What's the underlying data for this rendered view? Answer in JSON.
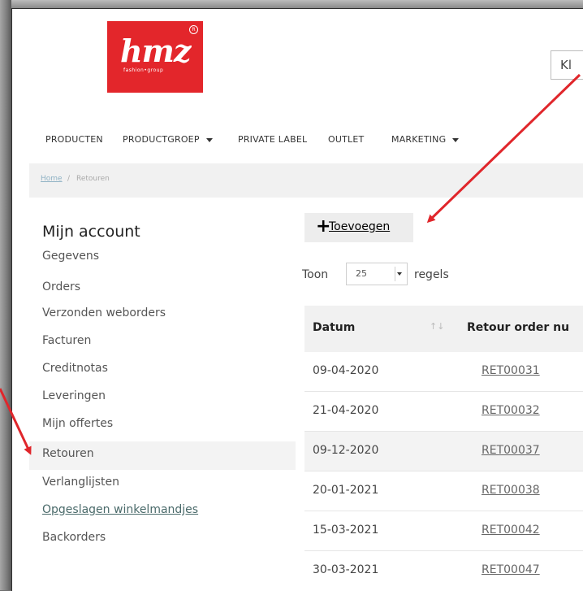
{
  "logo": {
    "text": "hmz",
    "subtext": "fashion•group",
    "reg_mark": "R"
  },
  "search": {
    "partial_text": "Kl"
  },
  "nav": {
    "items": [
      {
        "label": "PRODUCTEN",
        "dropdown": false
      },
      {
        "label": "PRODUCTGROEP",
        "dropdown": true
      },
      {
        "label": "PRIVATE LABEL",
        "dropdown": false
      },
      {
        "label": "OUTLET",
        "dropdown": false
      },
      {
        "label": "MARKETING",
        "dropdown": true
      }
    ]
  },
  "breadcrumb": {
    "home": "Home",
    "separator": "/",
    "current": "Retouren"
  },
  "sidebar": {
    "title": "Mijn account",
    "items": [
      {
        "label": "Gegevens"
      },
      {
        "label": "Orders"
      },
      {
        "label": "Verzonden weborders"
      },
      {
        "label": "Facturen"
      },
      {
        "label": "Creditnotas"
      },
      {
        "label": "Leveringen"
      },
      {
        "label": "Mijn offertes"
      },
      {
        "label": "Retouren",
        "active": true
      },
      {
        "label": "Verlanglijsten"
      },
      {
        "label": "Opgeslagen winkelmandjes",
        "link": true
      },
      {
        "label": "Backorders"
      }
    ]
  },
  "toolbar": {
    "add_label": "Toevoegen",
    "add_icon": "plus-icon"
  },
  "pagination": {
    "show_label": "Toon",
    "page_size": "25",
    "rows_label": "regels"
  },
  "table": {
    "headers": [
      "Datum",
      "Retour order nu"
    ],
    "sort_icon": "sort-icon",
    "rows": [
      {
        "date": "09-04-2020",
        "number": "RET00031"
      },
      {
        "date": "21-04-2020",
        "number": "RET00032"
      },
      {
        "date": "09-12-2020",
        "number": "RET00037"
      },
      {
        "date": "20-01-2021",
        "number": "RET00038"
      },
      {
        "date": "15-03-2021",
        "number": "RET00042"
      },
      {
        "date": "30-03-2021",
        "number": "RET00047"
      }
    ]
  },
  "colors": {
    "brand": "#e3262b",
    "annotation_arrow": "#e0262b",
    "link": "#8fb2c4"
  }
}
